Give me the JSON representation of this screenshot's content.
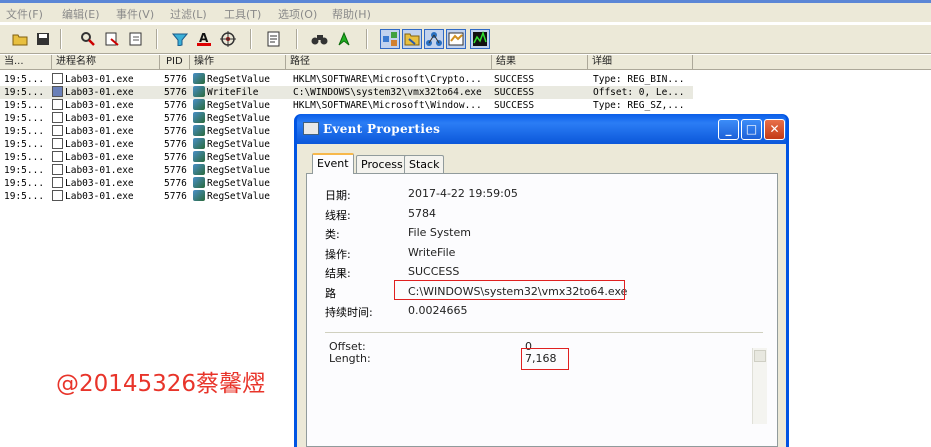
{
  "menu": [
    "文件(F)",
    "编辑(E)",
    "事件(V)",
    "过滤(L)",
    "工具(T)",
    "选项(O)",
    "帮助(H)"
  ],
  "toolbar": {
    "icons": [
      "open-icon",
      "save-icon",
      "magnifier-icon",
      "capture-icon",
      "autoscroll-icon",
      "filter-icon",
      "highlight-icon",
      "target-icon",
      "properties-icon",
      "find-icon",
      "jump-icon",
      "registry-icon",
      "file-icon",
      "network-icon",
      "process-icon",
      "profiling-icon"
    ]
  },
  "columns": [
    "当...",
    "进程名称",
    "PID",
    "操作",
    "路径",
    "结果",
    "详细"
  ],
  "rows": [
    {
      "time": "19:5...",
      "process": "Lab03-01.exe",
      "pid": "5776",
      "op": "RegSetValue",
      "path": "HKLM\\SOFTWARE\\Microsoft\\Crypto...",
      "result": "SUCCESS",
      "detail": "Type: REG_BIN..."
    },
    {
      "time": "19:5...",
      "process": "Lab03-01.exe",
      "pid": "5776",
      "op": "WriteFile",
      "path": "C:\\WINDOWS\\system32\\vmx32to64.exe",
      "result": "SUCCESS",
      "detail": "Offset: 0, Le..."
    },
    {
      "time": "19:5...",
      "process": "Lab03-01.exe",
      "pid": "5776",
      "op": "RegSetValue",
      "path": "HKLM\\SOFTWARE\\Microsoft\\Window...",
      "result": "SUCCESS",
      "detail": "Type: REG_SZ,..."
    },
    {
      "time": "19:5...",
      "process": "Lab03-01.exe",
      "pid": "5776",
      "op": "RegSetValue",
      "path": "",
      "result": "",
      "detail": ""
    },
    {
      "time": "19:5...",
      "process": "Lab03-01.exe",
      "pid": "5776",
      "op": "RegSetValue",
      "path": "",
      "result": "",
      "detail": ""
    },
    {
      "time": "19:5...",
      "process": "Lab03-01.exe",
      "pid": "5776",
      "op": "RegSetValue",
      "path": "",
      "result": "",
      "detail": ""
    },
    {
      "time": "19:5...",
      "process": "Lab03-01.exe",
      "pid": "5776",
      "op": "RegSetValue",
      "path": "",
      "result": "",
      "detail": ""
    },
    {
      "time": "19:5...",
      "process": "Lab03-01.exe",
      "pid": "5776",
      "op": "RegSetValue",
      "path": "",
      "result": "",
      "detail": ""
    },
    {
      "time": "19:5...",
      "process": "Lab03-01.exe",
      "pid": "5776",
      "op": "RegSetValue",
      "path": "",
      "result": "",
      "detail": ""
    },
    {
      "time": "19:5...",
      "process": "Lab03-01.exe",
      "pid": "5776",
      "op": "RegSetValue",
      "path": "",
      "result": "",
      "detail": ""
    }
  ],
  "selected_row": 1,
  "dialog": {
    "title": "Event Properties",
    "tabs": [
      "Event",
      "Process",
      "Stack"
    ],
    "fields": [
      {
        "label": "日期:",
        "value": "2017-4-22 19:59:05"
      },
      {
        "label": "线程:",
        "value": "5784"
      },
      {
        "label": "类:",
        "value": "File System"
      },
      {
        "label": "操作:",
        "value": "WriteFile"
      },
      {
        "label": "结果:",
        "value": "SUCCESS"
      },
      {
        "label": "路",
        "value": "C:\\WINDOWS\\system32\\vmx32to64.exe"
      },
      {
        "label": "持续时间:",
        "value": "0.0024665"
      }
    ],
    "details": [
      {
        "label": "Offset:",
        "value": "0"
      },
      {
        "label": "Length:",
        "value": "7,168"
      }
    ]
  },
  "watermark": "@20145326蔡馨熤",
  "colors": {
    "highlight_box": "#e02020",
    "watermark": "#e8342a",
    "titlebar": "#0054e3"
  }
}
